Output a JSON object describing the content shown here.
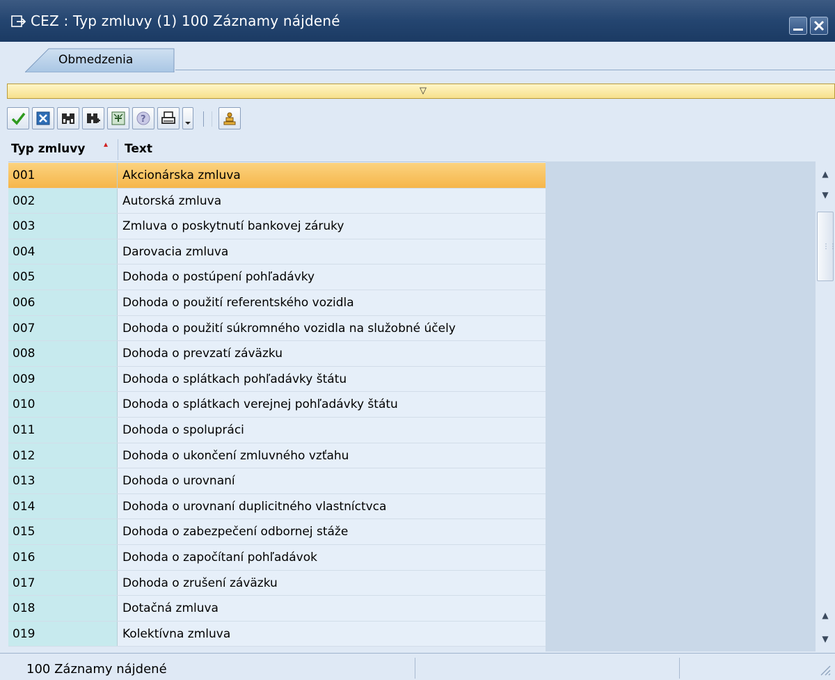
{
  "window": {
    "title": "CEZ : Typ zmluvy (1)  100 Záznamy nájdené"
  },
  "tabs": [
    {
      "label": "Obmedzenia"
    }
  ],
  "toolbar": {
    "buttons": [
      "accept-icon",
      "cancel-icon",
      "find-icon",
      "find-next-icon",
      "extended-search-icon",
      "help-icon",
      "print-icon",
      "print-menu-icon",
      "personalize-icon"
    ]
  },
  "grid": {
    "columns": [
      "Typ zmluvy",
      "Text"
    ],
    "sort_indicator": "ascending",
    "rows": [
      {
        "key": "001",
        "text": "Akcionárska zmluva",
        "selected": true
      },
      {
        "key": "002",
        "text": "Autorská zmluva"
      },
      {
        "key": "003",
        "text": "Zmluva o poskytnutí bankovej záruky"
      },
      {
        "key": "004",
        "text": "Darovacia zmluva"
      },
      {
        "key": "005",
        "text": "Dohoda o postúpení pohľadávky"
      },
      {
        "key": "006",
        "text": "Dohoda o použití referentského vozidla"
      },
      {
        "key": "007",
        "text": "Dohoda o použití súkromného vozidla na služobné účely"
      },
      {
        "key": "008",
        "text": "Dohoda o prevzatí záväzku"
      },
      {
        "key": "009",
        "text": "Dohoda o splátkach pohľadávky štátu"
      },
      {
        "key": "010",
        "text": "Dohoda o splátkach verejnej pohľadávky štátu"
      },
      {
        "key": "011",
        "text": "Dohoda o spolupráci"
      },
      {
        "key": "012",
        "text": "Dohoda o ukončení zmluvného vzťahu"
      },
      {
        "key": "013",
        "text": "Dohoda o urovnaní"
      },
      {
        "key": "014",
        "text": "Dohoda o urovnaní duplicitného vlastníctvca"
      },
      {
        "key": "015",
        "text": "Dohoda o zabezpečení odbornej stáže"
      },
      {
        "key": "016",
        "text": "Dohoda o započítaní pohľadávok"
      },
      {
        "key": "017",
        "text": "Dohoda o zrušení záväzku"
      },
      {
        "key": "018",
        "text": "Dotačná zmluva"
      },
      {
        "key": "019",
        "text": "Kolektívna zmluva"
      }
    ]
  },
  "status": {
    "message": "100 Záznamy nájdené"
  },
  "colors": {
    "titlebar": "#244570",
    "selected_row": "#f6b64a",
    "key_column": "#c7eaee"
  }
}
